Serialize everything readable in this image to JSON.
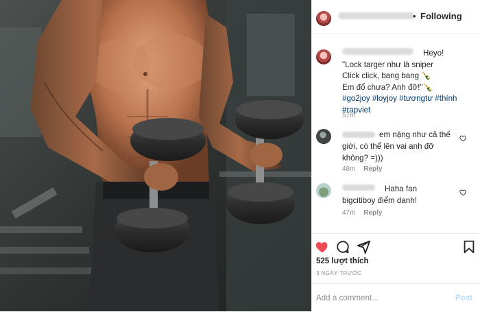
{
  "header": {
    "dot": "•",
    "follow_label": "Following"
  },
  "caption": {
    "lines": [
      "Heyo!",
      "\"Lock targer như là sniper",
      "Click click, bang bang 🍾",
      "Em đổ chưa? Anh đỡ!\"🍾"
    ],
    "hashtags_line1": "#go2joy #loyjoy #tươngtư #thính",
    "hashtags_line2": "#rapviet",
    "time": "57m"
  },
  "comments": [
    {
      "lines": [
        "em nặng như cả thế",
        "giới, có thể lên vai anh đỡ",
        "không? =)))"
      ],
      "time": "48m",
      "reply_label": "Reply"
    },
    {
      "lines": [
        "Haha fan",
        "bigcitiboy điểm danh!"
      ],
      "time": "47m",
      "reply_label": "Reply"
    }
  ],
  "actions": {
    "icons": [
      "heart-filled-icon",
      "comment-icon",
      "share-icon",
      "bookmark-icon"
    ],
    "like_color": "#ed4956",
    "likes": "525 lượt thích",
    "timestamp": "3 NGÀY TRƯỚC"
  },
  "add_comment": {
    "placeholder": "Add a comment...",
    "post_label": "Post"
  }
}
